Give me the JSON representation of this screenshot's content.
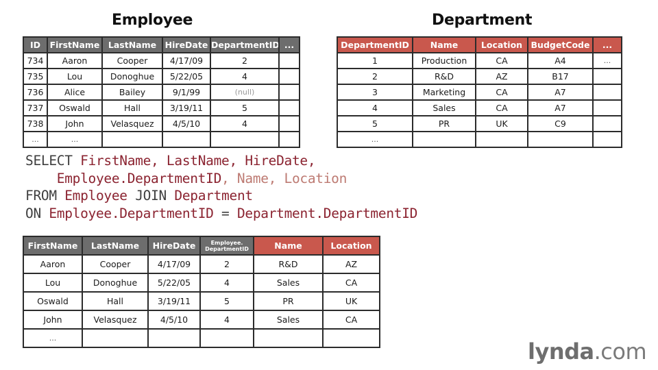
{
  "employee": {
    "title": "Employee",
    "headers": [
      "ID",
      "FirstName",
      "LastName",
      "HireDate",
      "DepartmentID",
      "..."
    ],
    "rows": [
      [
        "734",
        "Aaron",
        "Cooper",
        "4/17/09",
        "2",
        ""
      ],
      [
        "735",
        "Lou",
        "Donoghue",
        "5/22/05",
        "4",
        ""
      ],
      [
        "736",
        "Alice",
        "Bailey",
        "9/1/99",
        "(null)",
        ""
      ],
      [
        "737",
        "Oswald",
        "Hall",
        "3/19/11",
        "5",
        ""
      ],
      [
        "738",
        "John",
        "Velasquez",
        "4/5/10",
        "4",
        ""
      ],
      [
        "...",
        "...",
        "",
        "",
        "",
        ""
      ]
    ]
  },
  "department": {
    "title": "Department",
    "headers": [
      "DepartmentID",
      "Name",
      "Location",
      "BudgetCode",
      "..."
    ],
    "rows": [
      [
        "1",
        "Production",
        "CA",
        "A4",
        "..."
      ],
      [
        "2",
        "R&D",
        "AZ",
        "B17",
        ""
      ],
      [
        "3",
        "Marketing",
        "CA",
        "A7",
        ""
      ],
      [
        "4",
        "Sales",
        "CA",
        "A7",
        ""
      ],
      [
        "5",
        "PR",
        "UK",
        "C9",
        ""
      ],
      [
        "...",
        "",
        "",
        "",
        ""
      ]
    ]
  },
  "sql": {
    "line1": {
      "kw": "SELECT",
      "cols": "FirstName, LastName, HireDate,"
    },
    "line2": {
      "indent": "    ",
      "col": "Employee.DepartmentID",
      "extra": ", Name, Location"
    },
    "line3": {
      "kw1": "FROM",
      "t1": "Employee",
      "kw2": "JOIN",
      "t2": "Department"
    },
    "line4": {
      "kw": "ON",
      "left": "Employee.DepartmentID",
      "op": "=",
      "right": "Department.DepartmentID"
    }
  },
  "result": {
    "headers": [
      "FirstName",
      "LastName",
      "HireDate",
      "Employee.",
      "DepartmentID",
      "Name",
      "Location"
    ],
    "rows": [
      [
        "Aaron",
        "Cooper",
        "4/17/09",
        "2",
        "R&D",
        "AZ"
      ],
      [
        "Lou",
        "Donoghue",
        "5/22/05",
        "4",
        "Sales",
        "CA"
      ],
      [
        "Oswald",
        "Hall",
        "3/19/11",
        "5",
        "PR",
        "UK"
      ],
      [
        "John",
        "Velasquez",
        "4/5/10",
        "4",
        "Sales",
        "CA"
      ],
      [
        "...",
        "",
        "",
        "",
        "",
        ""
      ]
    ]
  },
  "logo": {
    "bold": "lynda",
    "rest": ".com"
  },
  "colors": {
    "gray_header": "#6d6d6d",
    "red_header": "#c9584d",
    "sql_identifier": "#8b2330",
    "sql_added": "#bd7a72"
  }
}
